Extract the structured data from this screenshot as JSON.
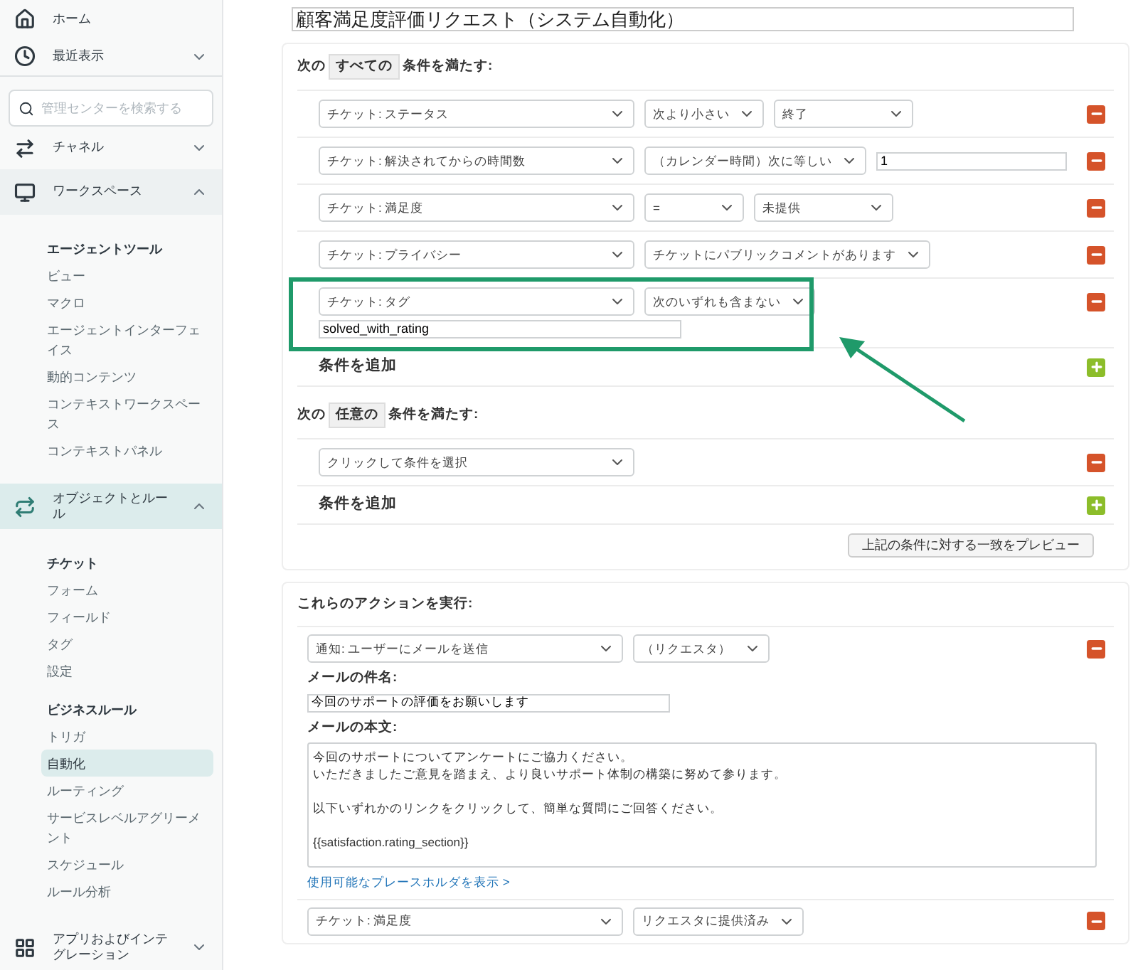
{
  "sidebar": {
    "top_items": [
      {
        "kind": "home",
        "label": "ホーム",
        "expandable": false,
        "active": false
      },
      {
        "kind": "clock",
        "label": "最近表示",
        "expandable": true,
        "expanded": false,
        "active": false
      }
    ],
    "search": {
      "placeholder": "管理センターを検索する"
    },
    "sections": [
      {
        "kind": "channel",
        "label": "チャネル",
        "expanded": false,
        "active": false
      },
      {
        "kind": "monitor",
        "label": "ワークスペース",
        "expanded": true,
        "active": false,
        "groups": [
          {
            "heading": "エージェントツール",
            "items": [
              {
                "label": "ビュー",
                "selected": false
              },
              {
                "label": "マクロ",
                "selected": false
              },
              {
                "label": "エージェントインターフェイス",
                "selected": false
              },
              {
                "label": "動的コンテンツ",
                "selected": false
              },
              {
                "label": "コンテキストワークスペース",
                "selected": false
              },
              {
                "label": "コンテキストパネル",
                "selected": false
              }
            ]
          }
        ]
      },
      {
        "kind": "objects",
        "label": "オブジェクトとルール",
        "expanded": true,
        "active": true,
        "groups": [
          {
            "heading": "チケット",
            "items": [
              {
                "label": "フォーム",
                "selected": false
              },
              {
                "label": "フィールド",
                "selected": false
              },
              {
                "label": "タグ",
                "selected": false
              },
              {
                "label": "設定",
                "selected": false
              }
            ]
          },
          {
            "heading": "ビジネスルール",
            "items": [
              {
                "label": "トリガ",
                "selected": false
              },
              {
                "label": "自動化",
                "selected": true
              },
              {
                "label": "ルーティング",
                "selected": false
              },
              {
                "label": "サービスレベルアグリーメント",
                "selected": false
              },
              {
                "label": "スケジュール",
                "selected": false
              },
              {
                "label": "ルール分析",
                "selected": false
              }
            ]
          }
        ]
      },
      {
        "kind": "apps",
        "label": "アプリおよびインテグレーション",
        "expanded": false,
        "active": false
      }
    ]
  },
  "title": "顧客満足度評価リクエスト（システム自動化）",
  "all_conditions": {
    "prefix": "次の",
    "mode": "すべての",
    "suffix": "条件を満たす:",
    "rows": [
      {
        "kind": "select",
        "field": "チケット: ステータス",
        "operator": "次より小さい",
        "value": "終了",
        "highlighted": false
      },
      {
        "kind": "input",
        "field": "チケット: 解決されてからの時間数",
        "operator": "（カレンダー時間）次に等しい",
        "value": "1",
        "highlighted": false
      },
      {
        "kind": "select",
        "field": "チケット: 満足度",
        "operator": "=",
        "value": "未提供",
        "highlighted": false
      },
      {
        "kind": "none",
        "field": "チケット: プライバシー",
        "operator": "チケットにパブリックコメントがあります",
        "highlighted": false
      },
      {
        "kind": "tag",
        "field": "チケット: タグ",
        "operator": "次のいずれも含まない",
        "value": "solved_with_rating",
        "highlighted": true
      }
    ],
    "add_label": "条件を追加"
  },
  "any_conditions": {
    "prefix": "次の",
    "mode": "任意の",
    "suffix": "条件を満たす:",
    "rows": [
      {
        "field": "クリックして条件を選択",
        "highlighted": false
      }
    ],
    "add_label": "条件を追加"
  },
  "preview_button": "上記の条件に対する一致をプレビュー",
  "actions": {
    "heading": "これらのアクションを実行:",
    "email_action": {
      "field": "通知: ユーザーにメールを送信",
      "target": "（リクエスタ）",
      "subject_label": "メールの件名:",
      "subject": "今回のサポートの評価をお願いします",
      "body_label": "メールの本文:",
      "body_paragraphs": [
        [
          "今回のサポートについてアンケートにご協力ください。",
          "いただきましたご意見を踏まえ、より良いサポート体制の構築に努めて参ります。"
        ],
        [
          "以下いずれかのリンクをクリックして、簡単な質問にご回答ください。"
        ],
        [
          "{{satisfaction.rating_section}}"
        ]
      ],
      "placeholder_link": "使用可能なプレースホルダを表示 >"
    },
    "rows": [
      {
        "field": "チケット: 満足度",
        "operator": "リクエスタに提供済み"
      }
    ]
  }
}
